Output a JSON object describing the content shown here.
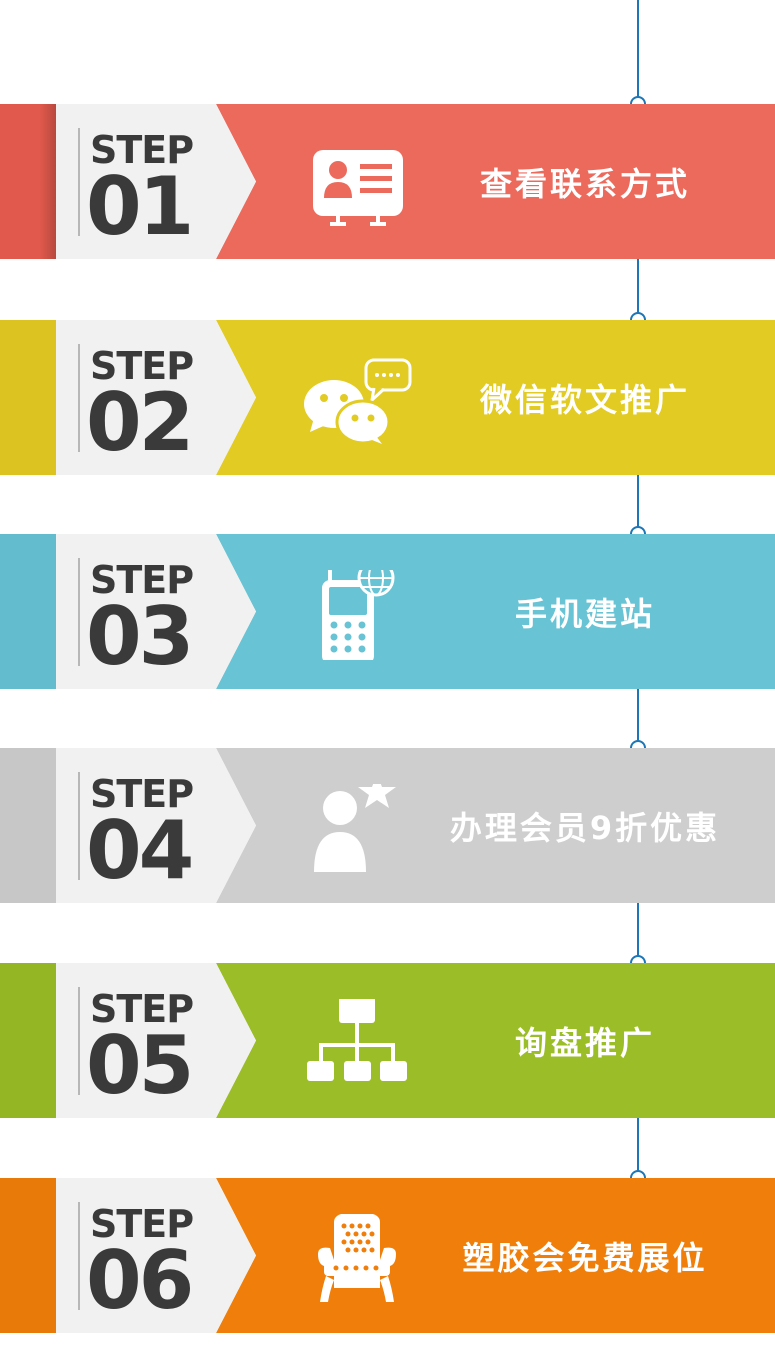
{
  "colors": {
    "line": "#1c76b7",
    "tab": "#f1f1f1",
    "text_dark": "#3a3a3a"
  },
  "steps": [
    {
      "step_label": "STEP",
      "number": "01",
      "title": "查看联系方式",
      "icon": "contact-card-icon",
      "color": "#ec6a5c",
      "accent": "#e0594c"
    },
    {
      "step_label": "STEP",
      "number": "02",
      "title": "微信软文推广",
      "icon": "wechat-icon",
      "color": "#e2cb23",
      "accent": "#ddc321"
    },
    {
      "step_label": "STEP",
      "number": "03",
      "title": "手机建站",
      "icon": "mobile-globe-icon",
      "color": "#68c3d4",
      "accent": "#62bccd"
    },
    {
      "step_label": "STEP",
      "number": "04",
      "title": "办理会员9折优惠",
      "icon": "member-star-icon",
      "color": "#cecece",
      "accent": "#c7c7c7"
    },
    {
      "step_label": "STEP",
      "number": "05",
      "title": "询盘推广",
      "icon": "sitemap-icon",
      "color": "#9bbd27",
      "accent": "#94b524"
    },
    {
      "step_label": "STEP",
      "number": "06",
      "title": "塑胶会免费展位",
      "icon": "throne-chair-icon",
      "color": "#ef7f0a",
      "accent": "#e77a08"
    }
  ]
}
